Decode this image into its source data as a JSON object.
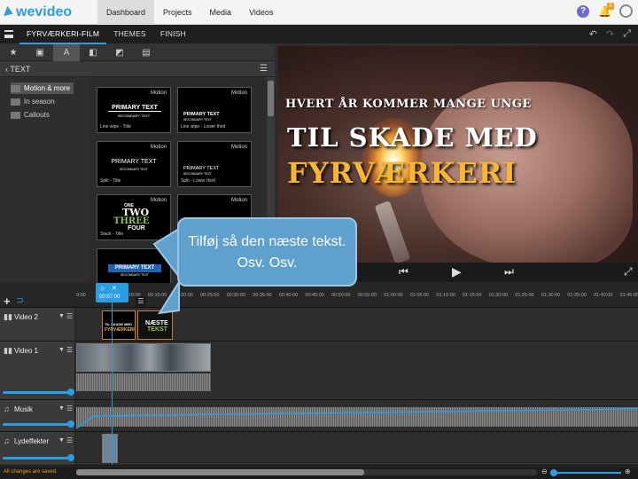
{
  "app": {
    "logo": "wevideo"
  },
  "nav": [
    "Dashboard",
    "Projects",
    "Media",
    "Videos"
  ],
  "header": {
    "help": "?",
    "notifications_count": "3"
  },
  "project": {
    "tabs": [
      "FYRVÆRKERI-FILM",
      "THEMES",
      "FINISH"
    ]
  },
  "left_tabs": [
    "★",
    "▣",
    "A",
    "◧",
    "◩",
    "▤"
  ],
  "text_panel": {
    "title": "TEXT",
    "back": "‹"
  },
  "categories": [
    "Motion & more",
    "In season",
    "Callouts"
  ],
  "thumbs": [
    {
      "badge": "Motion",
      "caption": "Line wipe - Title",
      "preview": "PRIMARY TEXT",
      "sub": "SECONDARY TEXT"
    },
    {
      "badge": "Motion",
      "caption": "Line wipe - Lower third",
      "preview": "PRIMARY TEXT",
      "sub": "SECONDARY TEXT"
    },
    {
      "badge": "Motion",
      "caption": "Split - Title",
      "preview": "PRIMARY TEXT",
      "sub": "SECONDARY TEXT"
    },
    {
      "badge": "Motion",
      "caption": "Split - Lower third",
      "preview": "PRIMARY TEXT",
      "sub": "SECONDARY TEXT"
    },
    {
      "badge": "Motion",
      "caption": "Stack - Title",
      "preview": "ONE TWO THREE FOUR",
      "sub": ""
    },
    {
      "badge": "Motion",
      "caption": "",
      "preview": "",
      "sub": ""
    },
    {
      "badge": "",
      "caption": "",
      "preview": "PRIMARY TEXT",
      "sub": "SECONDARY TEXT"
    }
  ],
  "stack_words": [
    "ONE",
    "TWO",
    "THREE",
    "FOUR"
  ],
  "preview": {
    "line1": "HVERT ÅR KOMMER MANGE UNGE",
    "line2": "TIL SKADE MED",
    "line3": "FYRVÆRKERI"
  },
  "callout": {
    "text": "Tilføj så den næste tekst. Osv. Osv."
  },
  "timeline": {
    "playhead_time": "00:07:00",
    "ruler": [
      "0:00",
      "00:05:00",
      "00:10:00",
      "00:15:00",
      "00:20:00",
      "00:25:00",
      "00:30:00",
      "00:35:00",
      "00:40:00",
      "00:45:00",
      "00:50:00",
      "00:55:00",
      "01:00:00",
      "01:05:00",
      "01:10:00",
      "01:15:00",
      "01:20:00",
      "01:25:00",
      "01:30:00",
      "01:35:00",
      "01:40:00",
      "01:45:00"
    ],
    "tracks": [
      "Video 2",
      "Video 1",
      "Musik",
      "Lydeffekter"
    ],
    "clip_v2a_lines": [
      "TIL SKADE MED",
      "FYRVÆRKERI"
    ],
    "clip_v2b_lines": [
      "NÆSTE",
      "TEKST"
    ]
  },
  "status": {
    "message": "All changes are saved."
  },
  "colors": {
    "accent": "#2b9de3",
    "title_yellow": "#f7b731"
  }
}
